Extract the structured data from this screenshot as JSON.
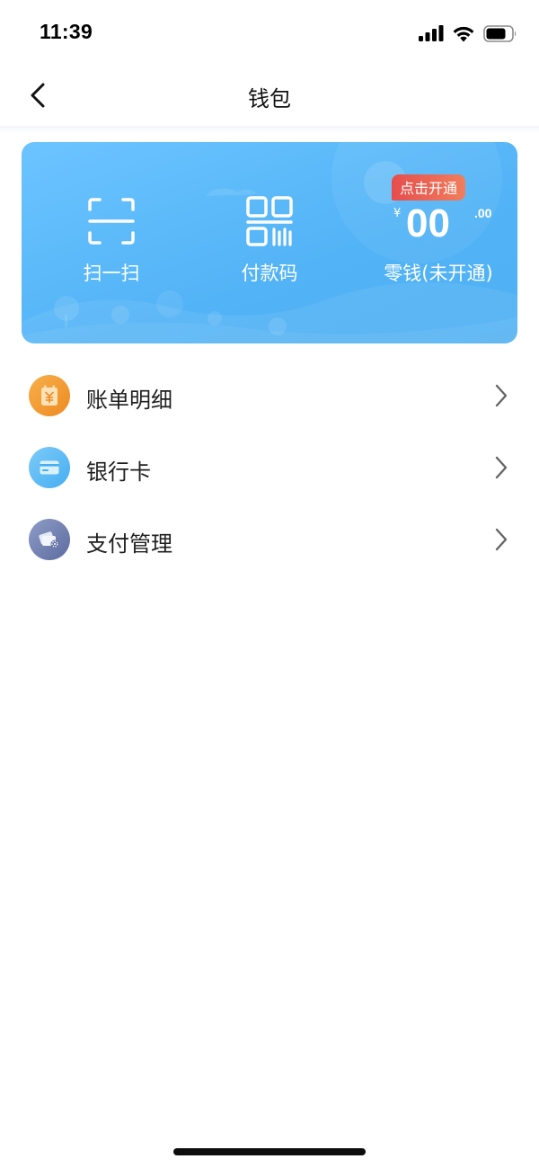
{
  "status_bar": {
    "time": "11:39"
  },
  "nav": {
    "title": "钱包"
  },
  "wallet_card": {
    "scan": {
      "label": "扫一扫",
      "icon": "scan-icon"
    },
    "pay_code": {
      "label": "付款码",
      "icon": "pay-code-icon"
    },
    "change": {
      "badge": "点击开通",
      "currency": "¥",
      "amount": "00",
      "cents": ".00",
      "label": "零钱(未开通)"
    }
  },
  "menu": {
    "items": [
      {
        "label": "账单明细",
        "icon": "bill-icon",
        "color": "#f39a2e"
      },
      {
        "label": "银行卡",
        "icon": "bank-card-icon",
        "color": "#5cb8f5"
      },
      {
        "label": "支付管理",
        "icon": "payment-settings-icon",
        "color": "#6f7fb0"
      }
    ]
  },
  "colors": {
    "card_gradient_start": "#6cc4ff",
    "card_gradient_end": "#4fb0f3",
    "badge_red": "#e64d4d"
  }
}
